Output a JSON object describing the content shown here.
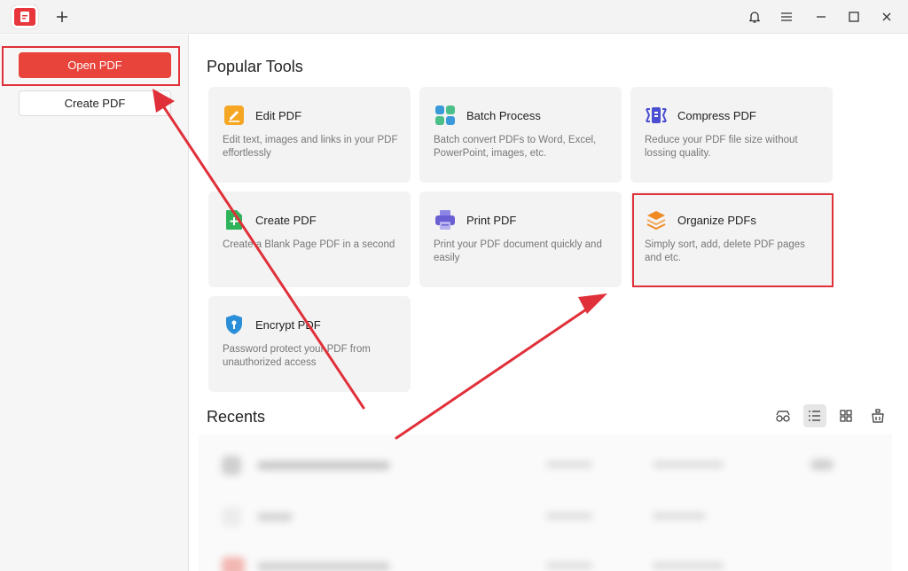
{
  "titlebar": {
    "app_icon": "pdf-app-logo-icon",
    "new_tab_icon": "plus-icon",
    "icons": [
      "bell-icon",
      "menu-icon",
      "minimize-icon",
      "maximize-icon",
      "close-icon"
    ]
  },
  "sidebar": {
    "open_pdf_label": "Open PDF",
    "create_pdf_label": "Create PDF"
  },
  "popular_tools": {
    "title": "Popular Tools",
    "tools": [
      {
        "title": "Edit PDF",
        "desc": "Edit text, images and links in your PDF effortlessly",
        "icon": "edit-pdf-icon",
        "color": "#f5a623"
      },
      {
        "title": "Batch Process",
        "desc": "Batch convert PDFs to Word, Excel, PowerPoint, images, etc.",
        "icon": "batch-process-icon",
        "color": "#3a9ad9"
      },
      {
        "title": "Compress PDF",
        "desc": "Reduce your PDF file size without lossing quality.",
        "icon": "compress-pdf-icon",
        "color": "#4a4ed1"
      },
      {
        "title": "Create PDF",
        "desc": "Create a Blank Page PDF in a second",
        "icon": "create-pdf-icon",
        "color": "#2fb35a"
      },
      {
        "title": "Print PDF",
        "desc": "Print your PDF document quickly and easily",
        "icon": "print-pdf-icon",
        "color": "#6a5fd3"
      },
      {
        "title": "Organize PDFs",
        "desc": "Simply sort, add, delete PDF pages and etc.",
        "icon": "organize-pdfs-icon",
        "color": "#f08a24"
      },
      {
        "title": "Encrypt PDF",
        "desc": "Password protect your PDF from unauthorized access",
        "icon": "encrypt-pdf-icon",
        "color": "#2a8ed8"
      }
    ]
  },
  "recents": {
    "title": "Recents",
    "view_icons": [
      "glasses-icon",
      "list-view-icon",
      "grid-view-icon",
      "clean-icon"
    ]
  },
  "colors": {
    "accent": "#e8443b",
    "highlight": "#e0303a"
  }
}
